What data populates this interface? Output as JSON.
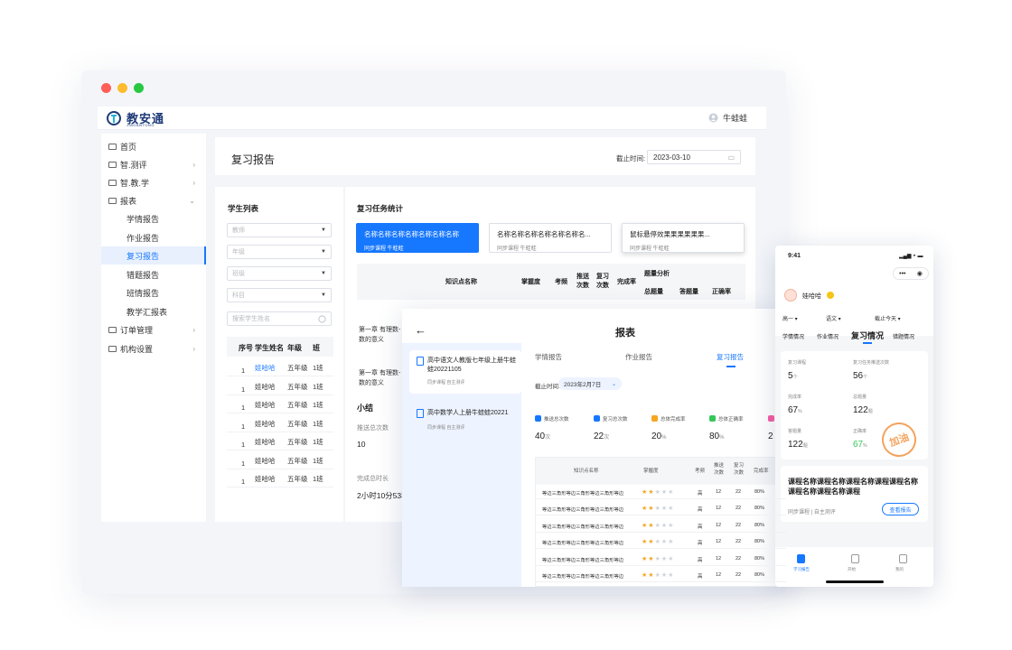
{
  "app": {
    "name": "教安通",
    "sub": "JIAOANTONG",
    "user": "牛蛙蛙"
  },
  "sidebar": {
    "items": [
      {
        "label": "首页",
        "type": "folder"
      },
      {
        "label": "智.测评",
        "type": "folder",
        "chev": "›"
      },
      {
        "label": "智.教.学",
        "type": "folder",
        "chev": "›"
      },
      {
        "label": "报表",
        "type": "folder",
        "chev": "⌄"
      },
      {
        "label": "学情报告",
        "type": "sub"
      },
      {
        "label": "作业报告",
        "type": "sub"
      },
      {
        "label": "复习报告",
        "type": "sub",
        "active": true
      },
      {
        "label": "错题报告",
        "type": "sub"
      },
      {
        "label": "班情报告",
        "type": "sub"
      },
      {
        "label": "教学汇报表",
        "type": "sub"
      },
      {
        "label": "订单管理",
        "type": "folder",
        "chev": "›"
      },
      {
        "label": "机构设置",
        "type": "folder",
        "chev": "›"
      }
    ]
  },
  "header": {
    "title": "复习报告",
    "deadline_label": "截止时间:",
    "deadline_value": "2023-03-10"
  },
  "student_list": {
    "title": "学生列表",
    "filters": [
      "教师",
      "年级",
      "班级",
      "科目"
    ],
    "search_placeholder": "搜索学生姓名",
    "columns": [
      "序号",
      "学生姓名",
      "年级",
      "班"
    ],
    "rows": [
      [
        "1",
        "娃哈哈",
        "五年级",
        "1班"
      ],
      [
        "1",
        "娃哈哈",
        "五年级",
        "1班"
      ],
      [
        "1",
        "娃哈哈",
        "五年级",
        "1班"
      ],
      [
        "1",
        "娃哈哈",
        "五年级",
        "1班"
      ],
      [
        "1",
        "娃哈哈",
        "五年级",
        "1班"
      ],
      [
        "1",
        "娃哈哈",
        "五年级",
        "1班"
      ],
      [
        "1",
        "娃哈哈",
        "五年级",
        "1班"
      ]
    ]
  },
  "task_stats": {
    "title": "复习任务统计",
    "cards": [
      {
        "title": "名称名称名称名称名称名称名称",
        "meta": "同步课程    牛蛙蛙"
      },
      {
        "title": "名称名称名称名称名称名称名...",
        "meta": "同步课程    牛蛙蛙"
      },
      {
        "title": "鼠标悬停效果果果果果果...",
        "meta": "同步课程    牛蛙蛙"
      }
    ],
    "columns": [
      "知识点名称",
      "掌握度",
      "考频",
      "推送次数",
      "复习次数",
      "完成率",
      "题量分析",
      "总题量",
      "答题量",
      "正确率"
    ],
    "rows": [
      "第一章 有理数-\n数的意义",
      "第一章 有理数-\n数的意义"
    ],
    "summary_title": "小结",
    "push_label": "推送总次数",
    "push_value": "10",
    "time_label": "完成总时长",
    "time_value": "2小时10分53秒"
  },
  "overlay": {
    "title": "报表",
    "courses": [
      {
        "title": "高中语文人教版七年级上册牛蛙蛙20221105",
        "meta": "同步课程    自主测评"
      },
      {
        "title": "高中数学人上册牛蛙蛙20221",
        "meta": "同步课程    自主测评"
      }
    ],
    "tabs": [
      "学情报告",
      "作业报告",
      "复习报告"
    ],
    "date_label": "截止时间:",
    "date_value": "2023年2月7日",
    "stats": [
      {
        "label": "推送总次数",
        "value": "40",
        "unit": "次",
        "color": "#1677ff"
      },
      {
        "label": "复习总次数",
        "value": "22",
        "unit": "次",
        "color": "#1677ff"
      },
      {
        "label": "总体完成率",
        "value": "20",
        "unit": "%",
        "color": "#f5a623"
      },
      {
        "label": "总体正确率",
        "value": "80",
        "unit": "%",
        "color": "#34c759"
      },
      {
        "label": "",
        "value": "2",
        "unit": "",
        "color": "#e85aa0"
      }
    ],
    "columns": [
      "知识点名称",
      "掌握度",
      "考频",
      "推送次数",
      "复习次数",
      "完成率"
    ],
    "rows": [
      [
        "等边三角形等边三角形等边三角形等边",
        2,
        "高",
        "12",
        "22",
        "80%"
      ],
      [
        "等边三角形等边三角形等边三角形等边",
        2,
        "高",
        "12",
        "22",
        "80%"
      ],
      [
        "等边三角形等边三角形等边三角形等边",
        2,
        "高",
        "12",
        "22",
        "80%"
      ],
      [
        "等边三角形等边三角形等边三角形等边",
        2,
        "高",
        "12",
        "22",
        "80%"
      ],
      [
        "等边三角形等边三角形等边三角形等边",
        2,
        "高",
        "12",
        "22",
        "80%"
      ],
      [
        "等边三角形等边三角形等边三角形等边",
        2,
        "高",
        "12",
        "22",
        "80%"
      ]
    ]
  },
  "phone": {
    "time": "9:41",
    "user": "娃哈哈",
    "filters": [
      "高一 ▾",
      "语文 ▾",
      "截止今天 ▾"
    ],
    "tabs": [
      "学情情况",
      "作业情况",
      "复习情况",
      "错题情况"
    ],
    "stats": [
      {
        "label": "复习课程",
        "value": "5",
        "unit": "个"
      },
      {
        "label": "复习任务推送次数",
        "value": "56",
        "unit": "个"
      },
      {
        "label": "完成率",
        "value": "67",
        "unit": "%"
      },
      {
        "label": "总题量",
        "value": "122",
        "unit": "题"
      },
      {
        "label": "答题量",
        "value": "122",
        "unit": "题"
      },
      {
        "label": "正确率",
        "value": "67",
        "unit": "%"
      }
    ],
    "stamp": "加油",
    "course_title": "课程名称课程名称课程名称课程课程名称课程名称课程名称课程",
    "course_meta": "同步课程  |  自主测评",
    "view_report": "查看报告",
    "nav": [
      "学习报告",
      "开始",
      "我的"
    ]
  }
}
